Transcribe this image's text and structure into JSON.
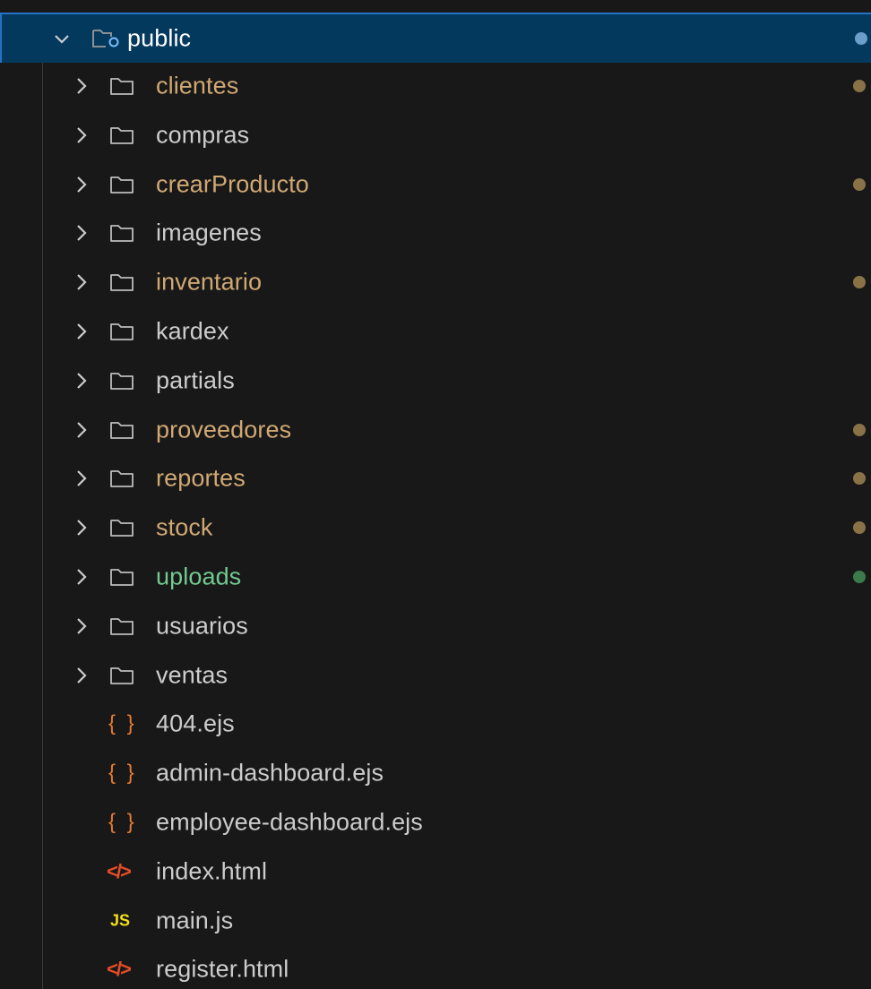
{
  "root": {
    "label": "public",
    "expanded": true,
    "icon": "folder-opened-icon",
    "status_color": "#3794ff"
  },
  "folders": [
    {
      "label": "clientes",
      "color": "#d0a874",
      "dot": "#8a7248"
    },
    {
      "label": "compras",
      "color": "#cccccc",
      "dot": null
    },
    {
      "label": "crearProducto",
      "color": "#d0a874",
      "dot": "#8a7248"
    },
    {
      "label": "imagenes",
      "color": "#cccccc",
      "dot": null
    },
    {
      "label": "inventario",
      "color": "#d0a874",
      "dot": "#8a7248"
    },
    {
      "label": "kardex",
      "color": "#cccccc",
      "dot": null
    },
    {
      "label": "partials",
      "color": "#cccccc",
      "dot": null
    },
    {
      "label": "proveedores",
      "color": "#d0a874",
      "dot": "#8a7248"
    },
    {
      "label": "reportes",
      "color": "#d0a874",
      "dot": "#8a7248"
    },
    {
      "label": "stock",
      "color": "#d0a874",
      "dot": "#8a7248"
    },
    {
      "label": "uploads",
      "color": "#73c991",
      "dot": "#3c7a4c"
    },
    {
      "label": "usuarios",
      "color": "#cccccc",
      "dot": null
    },
    {
      "label": "ventas",
      "color": "#cccccc",
      "dot": null
    }
  ],
  "files": [
    {
      "label": "404.ejs",
      "icon": "braces-icon",
      "glyph": "{ }",
      "icon_color": "#e37933"
    },
    {
      "label": "admin-dashboard.ejs",
      "icon": "braces-icon",
      "glyph": "{ }",
      "icon_color": "#e37933"
    },
    {
      "label": "employee-dashboard.ejs",
      "icon": "braces-icon",
      "glyph": "{ }",
      "icon_color": "#e37933"
    },
    {
      "label": "index.html",
      "icon": "html-icon",
      "glyph": "</>",
      "icon_color": "#e44d26"
    },
    {
      "label": "main.js",
      "icon": "js-icon",
      "glyph": "JS",
      "icon_color": "#f5de19"
    },
    {
      "label": "register.html",
      "icon": "html-icon",
      "glyph": "</>",
      "icon_color": "#e44d26"
    }
  ]
}
